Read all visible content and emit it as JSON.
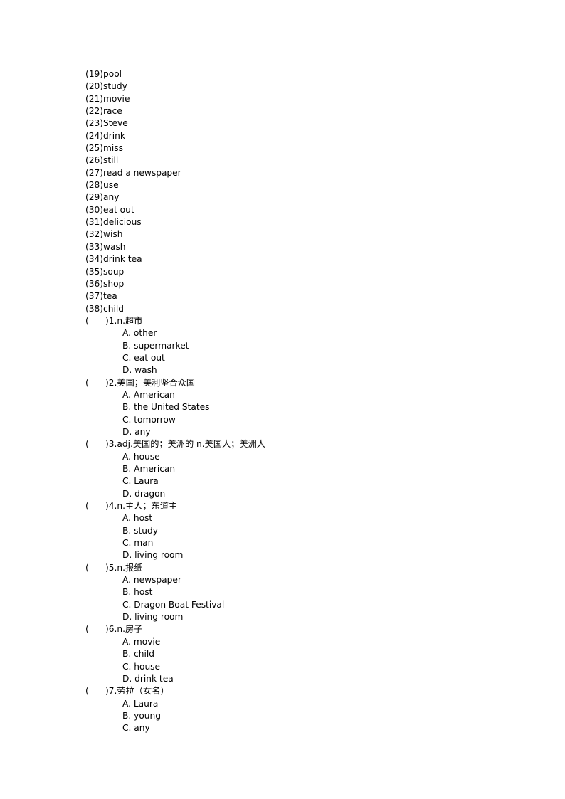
{
  "document": {
    "background_color": "#ffffff",
    "text_color": "#000000",
    "vocabulary_list": [
      {
        "number": "(19)",
        "term": "pool",
        "line": "(19)pool"
      },
      {
        "number": "(20)",
        "term": "study",
        "line": "(20)study"
      },
      {
        "number": "(21)",
        "term": "movie",
        "line": "(21)movie"
      },
      {
        "number": "(22)",
        "term": "race",
        "line": "(22)race"
      },
      {
        "number": "(23)",
        "term": "Steve",
        "line": "(23)Steve"
      },
      {
        "number": "(24)",
        "term": "drink",
        "line": "(24)drink"
      },
      {
        "number": "(25)",
        "term": "miss",
        "line": "(25)miss"
      },
      {
        "number": "(26)",
        "term": "still",
        "line": "(26)still"
      },
      {
        "number": "(27)",
        "term": "read a newspaper",
        "line": "(27)read a newspaper"
      },
      {
        "number": "(28)",
        "term": "use",
        "line": "(28)use"
      },
      {
        "number": "(29)",
        "term": "any",
        "line": "(29)any"
      },
      {
        "number": "(30)",
        "term": "eat out",
        "line": "(30)eat out"
      },
      {
        "number": "(31)",
        "term": "delicious",
        "line": "(31)delicious"
      },
      {
        "number": "(32)",
        "term": "wish",
        "line": "(32)wish"
      },
      {
        "number": "(33)",
        "term": "wash",
        "line": "(33)wash"
      },
      {
        "number": "(34)",
        "term": "drink tea",
        "line": "(34)drink tea"
      },
      {
        "number": "(35)",
        "term": "soup",
        "line": "(35)soup"
      },
      {
        "number": "(36)",
        "term": "shop",
        "line": "(36)shop"
      },
      {
        "number": "(37)",
        "term": "tea",
        "line": "(37)tea"
      },
      {
        "number": "(38)",
        "term": "child",
        "line": "(38)child"
      }
    ],
    "questions": [
      {
        "answer_blank": "(      )",
        "number": "1.",
        "prompt": "n.超市",
        "stem": "(      )1.n.超市",
        "options": [
          {
            "label": "A.",
            "text": "other",
            "line": "A. other"
          },
          {
            "label": "B.",
            "text": "supermarket",
            "line": "B. supermarket"
          },
          {
            "label": "C.",
            "text": "eat out",
            "line": "C. eat out"
          },
          {
            "label": "D.",
            "text": "wash",
            "line": "D. wash"
          }
        ]
      },
      {
        "answer_blank": "(      )",
        "number": "2.",
        "prompt": "美国；美利坚合众国",
        "stem": "(      )2.美国；美利坚合众国",
        "options": [
          {
            "label": "A.",
            "text": "American",
            "line": "A. American"
          },
          {
            "label": "B.",
            "text": "the United States",
            "line": "B. the United States"
          },
          {
            "label": "C.",
            "text": "tomorrow",
            "line": "C. tomorrow"
          },
          {
            "label": "D.",
            "text": "any",
            "line": "D. any"
          }
        ]
      },
      {
        "answer_blank": "(      )",
        "number": "3.",
        "prompt": "adj.美国的；美洲的 n.美国人；美洲人",
        "stem": "(      )3.adj.美国的；美洲的 n.美国人；美洲人",
        "options": [
          {
            "label": "A.",
            "text": "house",
            "line": "A. house"
          },
          {
            "label": "B.",
            "text": "American",
            "line": "B. American"
          },
          {
            "label": "C.",
            "text": "Laura",
            "line": "C. Laura"
          },
          {
            "label": "D.",
            "text": "dragon",
            "line": "D. dragon"
          }
        ]
      },
      {
        "answer_blank": "(      )",
        "number": "4.",
        "prompt": "n.主人；东道主",
        "stem": "(      )4.n.主人；东道主",
        "options": [
          {
            "label": "A.",
            "text": "host",
            "line": "A. host"
          },
          {
            "label": "B.",
            "text": "study",
            "line": "B. study"
          },
          {
            "label": "C.",
            "text": "man",
            "line": "C. man"
          },
          {
            "label": "D.",
            "text": "living room",
            "line": "D. living room"
          }
        ]
      },
      {
        "answer_blank": "(      )",
        "number": "5.",
        "prompt": "n.报纸",
        "stem": "(      )5.n.报纸",
        "options": [
          {
            "label": "A.",
            "text": "newspaper",
            "line": "A. newspaper"
          },
          {
            "label": "B.",
            "text": "host",
            "line": "B. host"
          },
          {
            "label": "C.",
            "text": "Dragon Boat Festival",
            "line": "C. Dragon Boat Festival"
          },
          {
            "label": "D.",
            "text": "living room",
            "line": "D. living room"
          }
        ]
      },
      {
        "answer_blank": "(      )",
        "number": "6.",
        "prompt": "n.房子",
        "stem": "(      )6.n.房子",
        "options": [
          {
            "label": "A.",
            "text": "movie",
            "line": "A. movie"
          },
          {
            "label": "B.",
            "text": "child",
            "line": "B. child"
          },
          {
            "label": "C.",
            "text": "house",
            "line": "C. house"
          },
          {
            "label": "D.",
            "text": "drink tea",
            "line": "D. drink tea"
          }
        ]
      },
      {
        "answer_blank": "(      )",
        "number": "7.",
        "prompt": "劳拉（女名）",
        "stem": "(      )7.劳拉（女名）",
        "options": [
          {
            "label": "A.",
            "text": "Laura",
            "line": "A. Laura"
          },
          {
            "label": "B.",
            "text": "young",
            "line": "B. young"
          },
          {
            "label": "C.",
            "text": "any",
            "line": "C. any"
          }
        ]
      }
    ]
  }
}
